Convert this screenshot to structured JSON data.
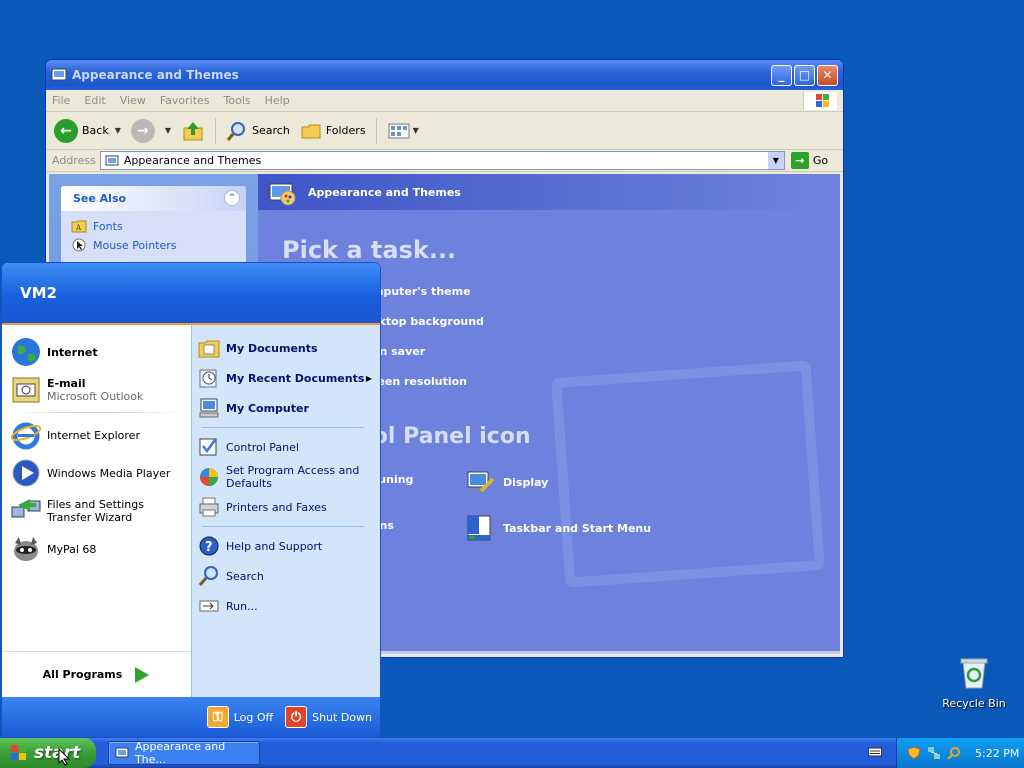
{
  "desktop": {
    "recycle_bin": "Recycle Bin"
  },
  "window": {
    "title": "Appearance and Themes",
    "menu": [
      "File",
      "Edit",
      "View",
      "Favorites",
      "Tools",
      "Help"
    ],
    "toolbar": {
      "back": "Back",
      "search": "Search",
      "folders": "Folders"
    },
    "address": {
      "label": "Address",
      "value": "Appearance and Themes",
      "go": "Go"
    },
    "see_also": {
      "title": "See Also",
      "items": [
        "Fonts",
        "Mouse Pointers"
      ]
    },
    "header": "Appearance and Themes",
    "pick_task": "Pick a task...",
    "tasks": [
      "mputer's theme",
      "sktop background",
      "en saver",
      "reen resolution"
    ],
    "pick_icon": "a Control Panel icon",
    "icons": [
      "Tuning",
      "Display",
      "ons",
      "Taskbar and Start Menu"
    ]
  },
  "start_menu": {
    "user": "VM2",
    "pinned": [
      {
        "title": "Internet",
        "subtitle": ""
      },
      {
        "title": "E-mail",
        "subtitle": "Microsoft Outlook"
      }
    ],
    "recent": [
      "Internet Explorer",
      "Windows Media Player",
      "Files and Settings Transfer Wizard",
      "MyPal 68"
    ],
    "all_programs": "All Programs",
    "right": {
      "my_documents": "My Documents",
      "my_recent_documents": "My Recent Documents",
      "my_computer": "My Computer",
      "control_panel": "Control Panel",
      "set_program_access": "Set Program Access and Defaults",
      "printers": "Printers and Faxes",
      "help": "Help and Support",
      "search": "Search",
      "run": "Run..."
    },
    "log_off": "Log Off",
    "shut_down": "Shut Down"
  },
  "taskbar": {
    "start": "start",
    "task": "Appearance and The...",
    "clock": "5:22 PM"
  },
  "colors": {
    "desktop": "#0a58b8",
    "start_green": "#3a9e36",
    "xp_blue": "#245edb"
  }
}
